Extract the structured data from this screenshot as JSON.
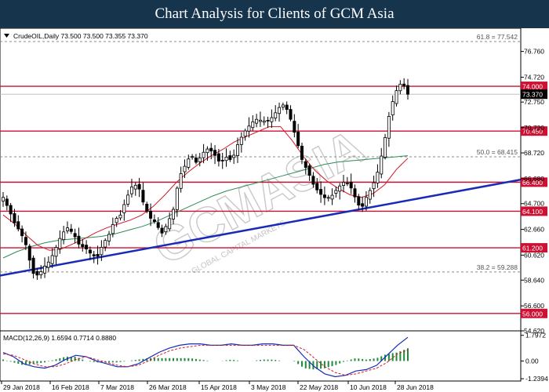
{
  "header": {
    "title": "Chart Analysis for Clients of GCM Asia"
  },
  "chart_data": {
    "type": "candlestick",
    "symbol_line": "CrudeOIL,Daily  73.500 73.500 73.355 73.370",
    "last_price": 73.37,
    "ylim": [
      54.62,
      78.6
    ],
    "y_ticks": [
      "76.760",
      "74.720",
      "72.750",
      "70.720",
      "68.720",
      "66.680",
      "64.700",
      "62.660",
      "60.620",
      "58.640",
      "56.600",
      "54.620"
    ],
    "x_ticks": [
      "29 Jan 2018",
      "16 Feb 2018",
      "7 Mar 2018",
      "26 Mar 2018",
      "15 Apr 2018",
      "3 May 2018",
      "22 May 2018",
      "10 Jun 2018",
      "28 Jun 2018"
    ],
    "levels": [
      {
        "value": 74.0,
        "label": "74.000",
        "color": "#cc1133"
      },
      {
        "value": 70.45,
        "label": "70.450",
        "color": "#cc1133"
      },
      {
        "value": 66.4,
        "label": "66.400",
        "color": "#cc1133"
      },
      {
        "value": 64.1,
        "label": "64.100",
        "color": "#cc1133"
      },
      {
        "value": 61.2,
        "label": "61.200",
        "color": "#cc1133"
      },
      {
        "value": 56.0,
        "label": "56.000",
        "color": "#cc1133"
      }
    ],
    "fib_levels": [
      {
        "value": 77.542,
        "label": "61.8 = 77.542"
      },
      {
        "value": 68.415,
        "label": "50.0 = 68.415"
      },
      {
        "value": 59.288,
        "label": "38.2 = 59.288"
      }
    ],
    "trendline": {
      "start": 59.0,
      "end": 66.6,
      "color": "#1a2ab8"
    },
    "price_path": [
      65.2,
      64.2,
      63.1,
      62.4,
      61.3,
      59.2,
      59.0,
      59.7,
      60.2,
      61.2,
      62.3,
      62.8,
      62.3,
      61.4,
      61.2,
      60.7,
      60.4,
      61.5,
      62.2,
      63.4,
      63.8,
      65.1,
      66.1,
      66.2,
      64.6,
      63.6,
      63.2,
      62.3,
      63.1,
      64.2,
      66.8,
      67.7,
      68.6,
      67.9,
      68.7,
      69.1,
      68.6,
      67.9,
      68.4,
      68.1,
      69.4,
      70.3,
      70.9,
      71.4,
      71.3,
      71.2,
      71.6,
      72.3,
      72.6,
      71.4,
      69.8,
      68.1,
      67.2,
      66.1,
      65.5,
      65.1,
      65.3,
      65.9,
      66.4,
      66.3,
      65.2,
      64.2,
      65.3,
      66.1,
      67.4,
      69.6,
      72.2,
      73.6,
      74.4,
      73.37
    ],
    "ma_red_path": [
      63.8,
      63.1,
      62.2,
      61.4,
      61.0,
      61.1,
      61.5,
      61.9,
      62.4,
      62.8,
      63.1,
      63.4,
      63.8,
      64.5,
      65.4,
      66.4,
      67.2,
      67.9,
      68.5,
      69.0,
      69.6,
      70.0,
      70.4,
      70.8,
      70.8,
      69.7,
      68.4,
      67.3,
      66.5,
      65.9,
      65.4,
      65.2,
      65.5,
      66.2,
      67.4,
      68.3
    ],
    "ma_green_path": [
      60.4,
      60.9,
      61.3,
      61.6,
      61.8,
      61.9,
      62.0,
      62.1,
      62.3,
      62.6,
      62.9,
      63.3,
      63.8,
      64.3,
      64.8,
      65.3,
      65.7,
      66.0,
      66.3,
      66.6,
      66.9,
      67.2,
      67.5,
      67.8,
      68.0,
      68.1,
      68.2,
      68.3,
      68.4,
      68.5
    ],
    "macd": {
      "label": "MACD(12,26,9)  1.6594  0.7714  0.8880",
      "ylim": [
        -1.4,
        2.0
      ],
      "y_ticks": [
        "1.7972",
        "0.00",
        "-1.2394"
      ],
      "macd_path": [
        0.6,
        0.3,
        -0.2,
        -0.4,
        -0.5,
        -0.3,
        0.1,
        0.4,
        0.3,
        0.0,
        -0.2,
        -0.4,
        -0.4,
        -0.2,
        0.2,
        0.6,
        0.9,
        1.1,
        1.2,
        1.2,
        1.1,
        1.1,
        1.2,
        1.1,
        1.1,
        1.2,
        1.2,
        1.1,
        1.1,
        0.3,
        -0.4,
        -0.9,
        -1.1,
        -1.0,
        -0.7,
        -0.6,
        -0.3,
        0.4,
        1.1,
        1.66
      ],
      "signal_path": [
        0.5,
        0.4,
        0.1,
        -0.2,
        -0.4,
        -0.4,
        -0.2,
        0.1,
        0.3,
        0.1,
        -0.1,
        -0.3,
        -0.4,
        -0.3,
        0.0,
        0.4,
        0.7,
        0.9,
        1.0,
        1.1,
        1.1,
        1.1,
        1.1,
        1.1,
        1.1,
        1.1,
        1.1,
        1.1,
        1.1,
        0.8,
        0.2,
        -0.4,
        -0.8,
        -1.0,
        -0.9,
        -0.7,
        -0.5,
        -0.1,
        0.5,
        0.77
      ],
      "hist_path": [
        0.1,
        -0.1,
        -0.3,
        -0.2,
        -0.1,
        0.1,
        0.3,
        0.3,
        0.0,
        -0.1,
        -0.1,
        -0.1,
        0.0,
        0.1,
        0.2,
        0.2,
        0.2,
        0.2,
        0.2,
        0.1,
        0.0,
        0.0,
        0.1,
        0.0,
        0.0,
        0.1,
        0.1,
        0.0,
        0.0,
        -0.5,
        -0.6,
        -0.5,
        -0.3,
        0.0,
        0.2,
        0.1,
        0.2,
        0.5,
        0.6,
        0.89
      ]
    },
    "watermark": {
      "main": "GCMASIA",
      "sub": "GLOBAL CAPITAL MARKETS"
    }
  }
}
